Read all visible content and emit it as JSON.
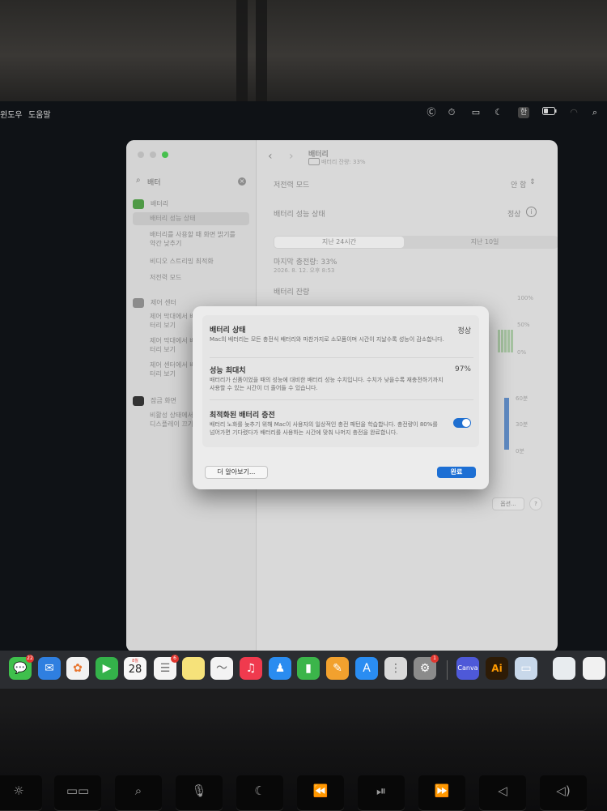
{
  "menubar": {
    "items": [
      "윈도우",
      "도움말"
    ],
    "status_icons": [
      "c-circle-icon",
      "stopwatch-icon",
      "display-icon",
      "moon-icon",
      "keyboard-layout-icon",
      "battery-icon",
      "wifi-icon",
      "search-icon"
    ],
    "input_source": "한"
  },
  "window": {
    "search": {
      "value": "배터"
    },
    "sidebar": {
      "items": [
        {
          "label": "배터리",
          "kind": "category",
          "icon": "battery-category-icon",
          "icon_color": "#4f9a46"
        },
        {
          "label": "배터리 성능 상태",
          "kind": "result",
          "selected": true
        },
        {
          "label": "배터리를 사용할 때 화면 밝기를 약간 낮추기",
          "kind": "result"
        },
        {
          "label": "비디오 스트리밍 최적화",
          "kind": "result"
        },
        {
          "label": "저전력 모드",
          "kind": "result"
        },
        {
          "label": "제어 센터",
          "kind": "category",
          "icon": "control-center-icon",
          "icon_color": "#8c8c8c"
        },
        {
          "label": "제어 막대에서 배터리 보기",
          "kind": "result"
        },
        {
          "label": "제어 막대에서 배터리 보기",
          "kind": "result"
        },
        {
          "label": "제어 센터에서 배터리 보기",
          "kind": "result"
        },
        {
          "label": "잠금 화면",
          "kind": "category",
          "icon": "lock-screen-icon",
          "icon_color": "#333333"
        },
        {
          "label": "비활성 상태에서 디스플레이 끄기",
          "kind": "result"
        }
      ]
    },
    "pane": {
      "title": "배터리",
      "subtitle": "배터리 잔량: 33%",
      "low_power_label": "저전력 모드",
      "low_power_value": "안 함",
      "health_label": "배터리 성능 상태",
      "health_value": "정상",
      "tabs": [
        "지난 24시간",
        "지난 10일"
      ],
      "last_charged_label": "마지막 충전량: 33%",
      "last_charged_time": "2026. 8. 12. 오후 8:53",
      "level_section": "배터리 잔량",
      "level_ticks": [
        "100%",
        "50%",
        "0%"
      ],
      "usage_ticks": [
        "60분",
        "30분",
        "0분"
      ],
      "options_button": "옵션...",
      "help_button": "?"
    }
  },
  "dialog": {
    "sections": [
      {
        "title": "배터리 상태",
        "description": "Mac의 배터리는 모든 충전식 배터리와 마찬가지로 소모품이며 시간이 지날수록 성능이 감소합니다.",
        "value": "정상"
      },
      {
        "title": "성능 최대치",
        "description": "배터리가 신품이었을 때의 성능에 대비한 배터리 성능 수치입니다. 수치가 낮을수록 재충전하기까지 사용할 수 있는 시간이 더 줄어들 수 있습니다.",
        "value": "97%"
      },
      {
        "title": "최적화된 배터리 충전",
        "description": "배터리 노화를 늦추기 위해 Mac이 사용자의 일상적인 충전 패턴을 학습합니다. 충전량이 80%를 넘어가면 기다렸다가 배터리를 사용하는 시간에 맞춰 나머지 충전을 완료합니다.",
        "toggle_on": true
      }
    ],
    "learn_more_button": "더 알아보기...",
    "done_button": "완료",
    "accent_color": "#1d6fd4"
  },
  "dock": {
    "apps": [
      {
        "name": "messages-app-icon",
        "color": "#3fc04c",
        "glyph": "💬",
        "badge": "22"
      },
      {
        "name": "mail-app-icon",
        "color": "#2f7fe0",
        "glyph": "✉"
      },
      {
        "name": "photos-app-icon",
        "color": "#f2f2f2",
        "glyph": "✿"
      },
      {
        "name": "facetime-app-icon",
        "color": "#34b24a",
        "glyph": "▶"
      },
      {
        "name": "calendar-app-icon",
        "color": "#f7f7f7",
        "glyph": "28",
        "top_label": "8월"
      },
      {
        "name": "reminders-app-icon",
        "color": "#f4f4f4",
        "glyph": "☰",
        "badge": "6"
      },
      {
        "name": "notes-app-icon",
        "color": "#f6e27a",
        "glyph": ""
      },
      {
        "name": "freeform-app-icon",
        "color": "#f3f3f3",
        "glyph": "〜"
      },
      {
        "name": "music-app-icon",
        "color": "#f03a4e",
        "glyph": "♫"
      },
      {
        "name": "keynote-app-icon",
        "color": "#2a8cf0",
        "glyph": "♟"
      },
      {
        "name": "numbers-app-icon",
        "color": "#3bb54a",
        "glyph": "▮"
      },
      {
        "name": "pages-app-icon",
        "color": "#f2a12e",
        "glyph": "✎"
      },
      {
        "name": "app-store-app-icon",
        "color": "#2a8df2",
        "glyph": "A"
      },
      {
        "name": "launchpad-app-icon",
        "color": "#d9d9d9",
        "glyph": "⋮"
      },
      {
        "name": "system-settings-app-icon",
        "color": "#8b8b8b",
        "glyph": "⚙",
        "badge": "1"
      },
      {
        "name": "canva-app-icon",
        "color": "#4e59d8",
        "glyph": "Canva"
      },
      {
        "name": "illustrator-app-icon",
        "color": "#2d1b06",
        "glyph": "Ai"
      },
      {
        "name": "preview-app-icon",
        "color": "#c8d8ea",
        "glyph": "▭"
      },
      {
        "name": "downloads-stack-icon",
        "color": "#e8ecef",
        "glyph": ""
      },
      {
        "name": "screenshot-stack-icon",
        "color": "#f1f1f1",
        "glyph": ""
      }
    ]
  },
  "keyboard": {
    "keys": [
      {
        "name": "brightness-key-icon",
        "glyph": "☼"
      },
      {
        "name": "mission-control-key-icon",
        "glyph": "▭▭"
      },
      {
        "name": "spotlight-key-icon",
        "glyph": "⌕"
      },
      {
        "name": "dictation-key-icon",
        "glyph": "🎙"
      },
      {
        "name": "do-not-disturb-key-icon",
        "glyph": "☾"
      },
      {
        "name": "rewind-key-icon",
        "glyph": "⏪"
      },
      {
        "name": "play-pause-key-icon",
        "glyph": "⏯"
      },
      {
        "name": "fast-forward-key-icon",
        "glyph": "⏩"
      },
      {
        "name": "mute-key-icon",
        "glyph": "◁"
      },
      {
        "name": "volume-down-key-icon",
        "glyph": "◁)"
      }
    ]
  }
}
